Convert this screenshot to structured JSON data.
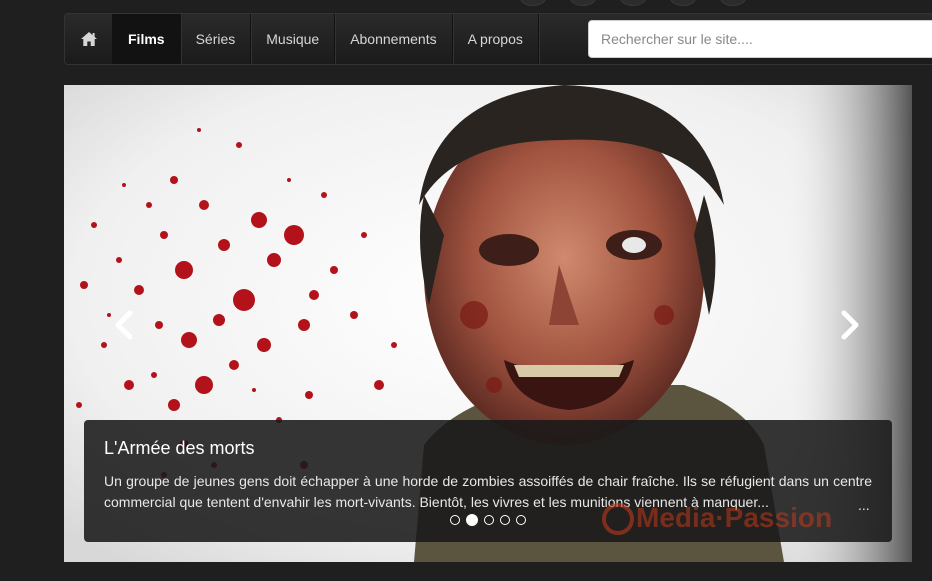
{
  "nav": {
    "home_icon": "home-icon",
    "items": [
      {
        "label": "Films",
        "active": true
      },
      {
        "label": "Séries",
        "active": false
      },
      {
        "label": "Musique",
        "active": false
      },
      {
        "label": "Abonnements",
        "active": false
      },
      {
        "label": "A propos",
        "active": false
      }
    ]
  },
  "search": {
    "placeholder": "Rechercher sur le site....",
    "value": ""
  },
  "carousel": {
    "slide_count": 5,
    "active_index": 1,
    "caption": {
      "title": "L'Armée des morts",
      "text": "Un groupe de jeunes gens doit échapper à une horde de zombies assoiffés de chair fraîche. Ils se réfugient dans un centre commercial que tentent d'envahir les mort-vivants. Bientôt, les vivres et les munitions viennent à manquer...",
      "more": "...",
      "watermark": "MediaPassion"
    },
    "prev_icon": "chevron-left-icon",
    "next_icon": "chevron-right-icon"
  },
  "colors": {
    "accent_blood": "#b3121b",
    "navbar_bg": "#222222",
    "page_bg": "#1f1f1f"
  }
}
